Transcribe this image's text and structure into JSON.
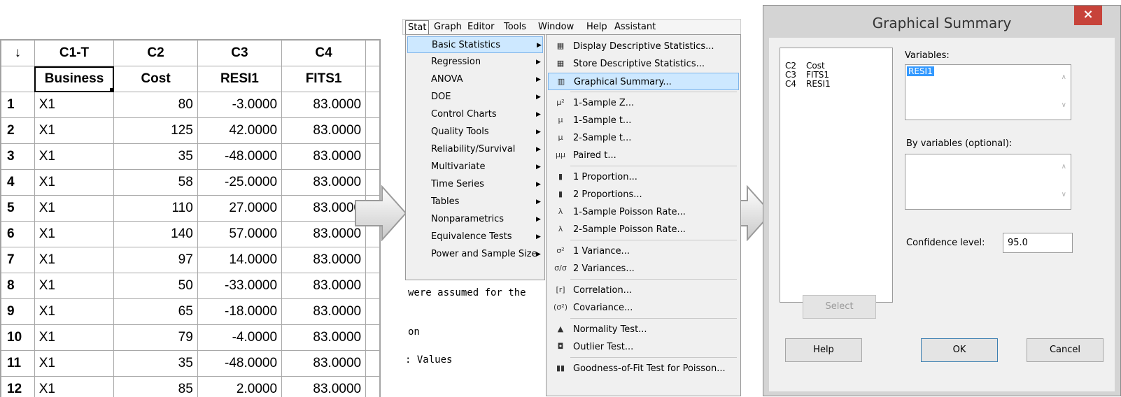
{
  "worksheet": {
    "corner_label": "↓",
    "column_ids": [
      "C1-T",
      "C2",
      "C3",
      "C4"
    ],
    "column_names": [
      "Business",
      "Cost",
      "RESI1",
      "FITS1"
    ],
    "rows": [
      {
        "n": "1",
        "cells": [
          "X1",
          "80",
          "-3.0000",
          "83.0000"
        ]
      },
      {
        "n": "2",
        "cells": [
          "X1",
          "125",
          "42.0000",
          "83.0000"
        ]
      },
      {
        "n": "3",
        "cells": [
          "X1",
          "35",
          "-48.0000",
          "83.0000"
        ]
      },
      {
        "n": "4",
        "cells": [
          "X1",
          "58",
          "-25.0000",
          "83.0000"
        ]
      },
      {
        "n": "5",
        "cells": [
          "X1",
          "110",
          "27.0000",
          "83.0000"
        ]
      },
      {
        "n": "6",
        "cells": [
          "X1",
          "140",
          "57.0000",
          "83.0000"
        ]
      },
      {
        "n": "7",
        "cells": [
          "X1",
          "97",
          "14.0000",
          "83.0000"
        ]
      },
      {
        "n": "8",
        "cells": [
          "X1",
          "50",
          "-33.0000",
          "83.0000"
        ]
      },
      {
        "n": "9",
        "cells": [
          "X1",
          "65",
          "-18.0000",
          "83.0000"
        ]
      },
      {
        "n": "10",
        "cells": [
          "X1",
          "79",
          "-4.0000",
          "83.0000"
        ]
      },
      {
        "n": "11",
        "cells": [
          "X1",
          "35",
          "-48.0000",
          "83.0000"
        ]
      },
      {
        "n": "12",
        "cells": [
          "X1",
          "85",
          "2.0000",
          "83.0000"
        ]
      }
    ]
  },
  "menubar": [
    "Stat",
    "Graph",
    "Editor",
    "Tools",
    "Window",
    "Help",
    "Assistant"
  ],
  "stat_menu": [
    {
      "label": "Basic Statistics",
      "highlighted": true
    },
    {
      "label": "Regression"
    },
    {
      "label": "ANOVA"
    },
    {
      "label": "DOE"
    },
    {
      "label": "Control Charts"
    },
    {
      "label": "Quality Tools"
    },
    {
      "label": "Reliability/Survival"
    },
    {
      "label": "Multivariate"
    },
    {
      "label": "Time Series"
    },
    {
      "label": "Tables"
    },
    {
      "label": "Nonparametrics"
    },
    {
      "label": "Equivalence Tests"
    },
    {
      "label": "Power and Sample Size"
    }
  ],
  "output_fragments": [
    "were assumed for the",
    "on",
    ":  Values"
  ],
  "basic_stats_menu": [
    {
      "label": "Display Descriptive Statistics...",
      "icon": "table-icon"
    },
    {
      "label": "Store Descriptive Statistics...",
      "icon": "table-icon"
    },
    {
      "label": "Graphical Summary...",
      "icon": "summary-chart-icon",
      "highlighted": true
    },
    {
      "label": "1-Sample Z...",
      "icon": "mu-z-icon",
      "sep_before": true
    },
    {
      "label": "1-Sample t...",
      "icon": "mu-icon"
    },
    {
      "label": "2-Sample t...",
      "icon": "mu-icon"
    },
    {
      "label": "Paired t...",
      "icon": "mu-mu-icon"
    },
    {
      "label": "1 Proportion...",
      "icon": "bar-icon",
      "sep_before": true
    },
    {
      "label": "2 Proportions...",
      "icon": "bar-icon"
    },
    {
      "label": "1-Sample Poisson Rate...",
      "icon": "lambda-icon"
    },
    {
      "label": "2-Sample Poisson Rate...",
      "icon": "lambda-icon"
    },
    {
      "label": "1 Variance...",
      "icon": "sigma-squared-icon",
      "sep_before": true
    },
    {
      "label": "2 Variances...",
      "icon": "sigma-ratio-icon"
    },
    {
      "label": "Correlation...",
      "icon": "correlation-icon",
      "sep_before": true
    },
    {
      "label": "Covariance...",
      "icon": "covariance-icon"
    },
    {
      "label": "Normality Test...",
      "icon": "normal-curve-icon",
      "sep_before": true
    },
    {
      "label": "Outlier Test...",
      "icon": "outlier-icon"
    },
    {
      "label": "Goodness-of-Fit Test for Poisson...",
      "icon": "fit-icon",
      "sep_before": true
    }
  ],
  "dialog": {
    "title": "Graphical Summary",
    "close_label": "×",
    "var_list": [
      {
        "col": "C2",
        "name": "Cost"
      },
      {
        "col": "C3",
        "name": "FITS1"
      },
      {
        "col": "C4",
        "name": "RESI1"
      }
    ],
    "variables_label": "Variables:",
    "variables_value": "RESI1",
    "by_variables_label": "By variables (optional):",
    "confidence_label": "Confidence level:",
    "confidence_value": "95.0",
    "select_label": "Select",
    "help_label": "Help",
    "ok_label": "OK",
    "cancel_label": "Cancel"
  }
}
